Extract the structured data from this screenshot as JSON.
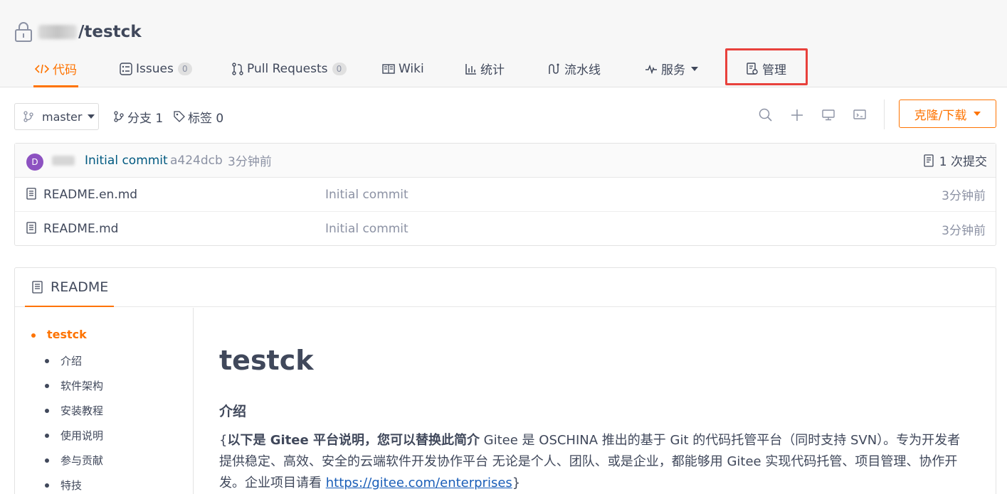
{
  "repo": {
    "name": "/testck"
  },
  "nav": {
    "code": "代码",
    "issues": "Issues",
    "issues_count": "0",
    "pull_requests": "Pull Requests",
    "pull_requests_count": "0",
    "wiki": "Wiki",
    "stats": "统计",
    "pipeline": "流水线",
    "services": "服务",
    "manage": "管理"
  },
  "toolbar": {
    "branch": "master",
    "branches_label": "分支 1",
    "tags_label": "标签 0",
    "clone_label": "克隆/下载"
  },
  "commit": {
    "avatar_letter": "D",
    "message": "Initial commit",
    "sha": "a424dcb",
    "time": "3分钟前",
    "count_label": "1 次提交"
  },
  "files": [
    {
      "name": "README.en.md",
      "message": "Initial commit",
      "time": "3分钟前"
    },
    {
      "name": "README.md",
      "message": "Initial commit",
      "time": "3分钟前"
    }
  ],
  "readme": {
    "tab_label": "README",
    "toc": [
      "testck",
      "介绍",
      "软件架构",
      "安装教程",
      "使用说明",
      "参与贡献",
      "特技"
    ],
    "title": "testck",
    "section": "介绍",
    "para_open": "{",
    "para_bold": "以下是 Gitee 平台说明，您可以替换此简介",
    "para_text": " Gitee 是 OSCHINA 推出的基于 Git 的代码托管平台（同时支持 SVN）。专为开发者提供稳定、高效、安全的云端软件开发协作平台 无论是个人、团队、或是企业，都能够用 Gitee 实现代码托管、项目管理、协作开发。企业项目请看 ",
    "para_link": "https://gitee.com/enterprises",
    "para_close": "}"
  },
  "colors": {
    "accent": "#fe7300",
    "highlight": "#e8413c",
    "link": "#005980",
    "muted": "#8c92a4"
  }
}
